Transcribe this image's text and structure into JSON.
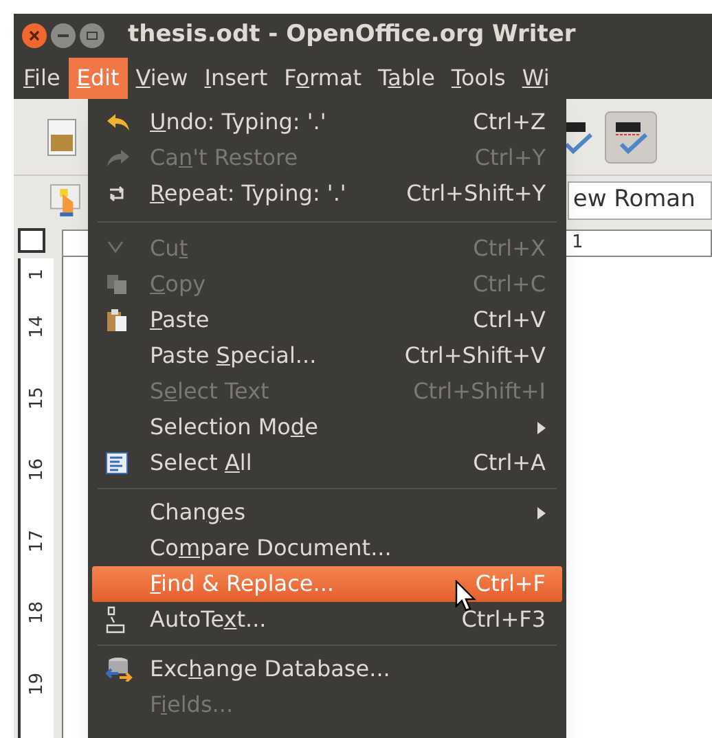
{
  "window": {
    "title": "thesis.odt - OpenOffice.org Writer"
  },
  "menubar": [
    {
      "key": "F",
      "post": "ile",
      "selected": false
    },
    {
      "key": "E",
      "post": "dit",
      "selected": true
    },
    {
      "key": "V",
      "post": "iew",
      "selected": false
    },
    {
      "key": "I",
      "post": "nsert",
      "selected": false
    },
    {
      "pre": "F",
      "key": "o",
      "post": "rmat",
      "selected": false
    },
    {
      "pre": "T",
      "key": "a",
      "post": "ble",
      "selected": false
    },
    {
      "key": "T",
      "post": "ools",
      "selected": false
    },
    {
      "key": "W",
      "post": "i",
      "selected": false
    }
  ],
  "toolbar": {
    "font_name": "ew Roman",
    "spellcheck_pressed": true
  },
  "ruler": {
    "top_mark": "1",
    "side_marks": [
      "1",
      "14",
      "15",
      "16",
      "17",
      "18",
      "19"
    ]
  },
  "edit_menu": {
    "items": [
      {
        "kind": "item",
        "key": "U",
        "post": "ndo: Typing: '.'",
        "shortcut": "Ctrl+Z",
        "disabled": false,
        "selected": false
      },
      {
        "kind": "item",
        "pre": "Ca",
        "key": "n",
        "post": "'t Restore",
        "shortcut": "Ctrl+Y",
        "disabled": true,
        "selected": false
      },
      {
        "kind": "item",
        "key": "R",
        "post": "epeat: Typing: '.'",
        "shortcut": "Ctrl+Shift+Y",
        "disabled": false,
        "selected": false
      },
      {
        "kind": "separator"
      },
      {
        "kind": "item",
        "pre": "Cu",
        "key": "t",
        "shortcut": "Ctrl+X",
        "disabled": true,
        "selected": false
      },
      {
        "kind": "item",
        "key": "C",
        "post": "opy",
        "shortcut": "Ctrl+C",
        "disabled": true,
        "selected": false
      },
      {
        "kind": "item",
        "key": "P",
        "post": "aste",
        "shortcut": "Ctrl+V",
        "disabled": false,
        "selected": false
      },
      {
        "kind": "item",
        "pre": "Paste ",
        "key": "S",
        "post": "pecial...",
        "shortcut": "Ctrl+Shift+V",
        "disabled": false,
        "selected": false
      },
      {
        "kind": "item",
        "pre": "S",
        "key": "e",
        "post": "lect Text",
        "shortcut": "Ctrl+Shift+I",
        "disabled": true,
        "selected": false
      },
      {
        "kind": "submenu",
        "pre": "Selection Mo",
        "key": "d",
        "post": "e",
        "disabled": false,
        "selected": false
      },
      {
        "kind": "item",
        "pre": "Select ",
        "key": "A",
        "post": "ll",
        "shortcut": "Ctrl+A",
        "disabled": false,
        "selected": false
      },
      {
        "kind": "separator"
      },
      {
        "kind": "submenu",
        "pre": "Chan",
        "key": "g",
        "post": "es",
        "disabled": false,
        "selected": false
      },
      {
        "kind": "item",
        "pre": "Co",
        "key": "m",
        "post": "pare Document...",
        "disabled": false,
        "selected": false
      },
      {
        "kind": "item",
        "key": "F",
        "post": "ind & Replace...",
        "shortcut": "Ctrl+F",
        "disabled": false,
        "selected": true
      },
      {
        "kind": "item",
        "pre": "AutoTe",
        "key": "x",
        "post": "t...",
        "shortcut": "Ctrl+F3",
        "disabled": false,
        "selected": false
      },
      {
        "kind": "separator"
      },
      {
        "kind": "item",
        "pre": "Exc",
        "key": "h",
        "post": "ange Database...",
        "disabled": false,
        "selected": false
      },
      {
        "kind": "item",
        "pre": "F",
        "key": "i",
        "post": "elds...",
        "disabled": true,
        "selected": false
      }
    ]
  }
}
